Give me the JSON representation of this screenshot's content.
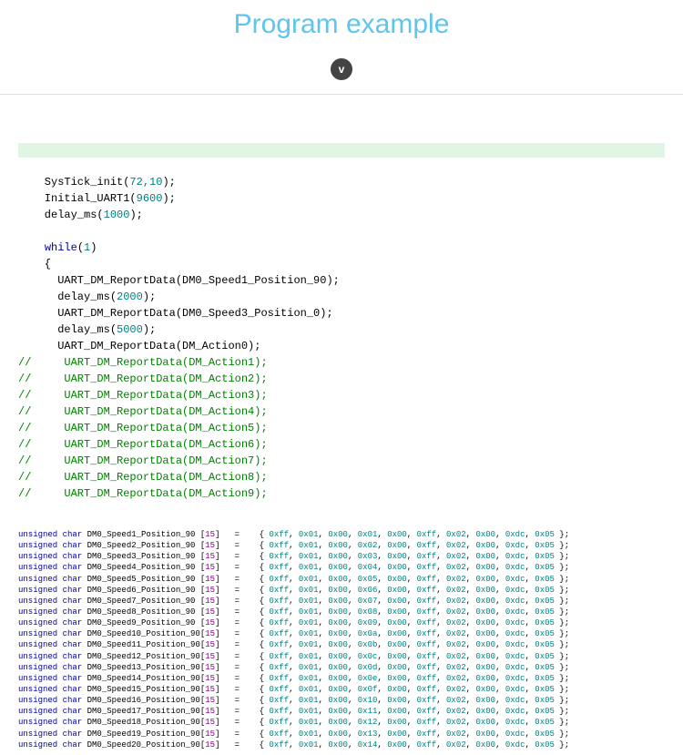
{
  "header": {
    "title": "Program example",
    "badge_char": "v"
  },
  "code": {
    "l1": "    SysTick_init(",
    "l1n": "72,10",
    "l1e": ");",
    "l2": "    Initial_UART1(",
    "l2n": "9600",
    "l2e": ");",
    "l3": "    delay_ms(",
    "l3n": "1000",
    "l3e": ");",
    "l4": "",
    "l5a": "    ",
    "l5b": "while",
    "l5c": "(",
    "l5d": "1",
    "l5e": ")",
    "l6": "    {",
    "l7": "      UART_DM_ReportData(DM0_Speed1_Position_90);",
    "l8": "      delay_ms(",
    "l8n": "2000",
    "l8e": ");",
    "l9": "      UART_DM_ReportData(DM0_Speed3_Position_0);",
    "l10": "      delay_ms(",
    "l10n": "5000",
    "l10e": ");",
    "l11": "      UART_DM_ReportData(DM_Action0);",
    "c1": "//     UART_DM_ReportData(DM_Action1);",
    "c2": "//     UART_DM_ReportData(DM_Action2);",
    "c3": "//     UART_DM_ReportData(DM_Action3);",
    "c4": "//     UART_DM_ReportData(DM_Action4);",
    "c5": "//     UART_DM_ReportData(DM_Action5);",
    "c6": "//     UART_DM_ReportData(DM_Action6);",
    "c7": "//     UART_DM_ReportData(DM_Action7);",
    "c8": "//     UART_DM_ReportData(DM_Action8);",
    "c9": "//     UART_DM_ReportData(DM_Action9);"
  },
  "arrays": [
    {
      "name": "DM0_Speed1_Position_90",
      "size": "15",
      "bytes": [
        "0xff",
        "0x01",
        "0x00",
        "0x01",
        "0x00",
        "0xff",
        "0x02",
        "0x00",
        "0xdc",
        "0x05"
      ]
    },
    {
      "name": "DM0_Speed2_Position_90",
      "size": "15",
      "bytes": [
        "0xff",
        "0x01",
        "0x00",
        "0x02",
        "0x00",
        "0xff",
        "0x02",
        "0x00",
        "0xdc",
        "0x05"
      ]
    },
    {
      "name": "DM0_Speed3_Position_90",
      "size": "15",
      "bytes": [
        "0xff",
        "0x01",
        "0x00",
        "0x03",
        "0x00",
        "0xff",
        "0x02",
        "0x00",
        "0xdc",
        "0x05"
      ]
    },
    {
      "name": "DM0_Speed4_Position_90",
      "size": "15",
      "bytes": [
        "0xff",
        "0x01",
        "0x00",
        "0x04",
        "0x00",
        "0xff",
        "0x02",
        "0x00",
        "0xdc",
        "0x05"
      ]
    },
    {
      "name": "DM0_Speed5_Position_90",
      "size": "15",
      "bytes": [
        "0xff",
        "0x01",
        "0x00",
        "0x05",
        "0x00",
        "0xff",
        "0x02",
        "0x00",
        "0xdc",
        "0x05"
      ]
    },
    {
      "name": "DM0_Speed6_Position_90",
      "size": "15",
      "bytes": [
        "0xff",
        "0x01",
        "0x00",
        "0x06",
        "0x00",
        "0xff",
        "0x02",
        "0x00",
        "0xdc",
        "0x05"
      ]
    },
    {
      "name": "DM0_Speed7_Position_90",
      "size": "15",
      "bytes": [
        "0xff",
        "0x01",
        "0x00",
        "0x07",
        "0x00",
        "0xff",
        "0x02",
        "0x00",
        "0xdc",
        "0x05"
      ]
    },
    {
      "name": "DM0_Speed8_Position_90",
      "size": "15",
      "bytes": [
        "0xff",
        "0x01",
        "0x00",
        "0x08",
        "0x00",
        "0xff",
        "0x02",
        "0x00",
        "0xdc",
        "0x05"
      ]
    },
    {
      "name": "DM0_Speed9_Position_90",
      "size": "15",
      "bytes": [
        "0xff",
        "0x01",
        "0x00",
        "0x09",
        "0x00",
        "0xff",
        "0x02",
        "0x00",
        "0xdc",
        "0x05"
      ]
    },
    {
      "name": "DM0_Speed10_Position_90",
      "size": "15",
      "bytes": [
        "0xff",
        "0x01",
        "0x00",
        "0x0a",
        "0x00",
        "0xff",
        "0x02",
        "0x00",
        "0xdc",
        "0x05"
      ]
    },
    {
      "name": "DM0_Speed11_Position_90",
      "size": "15",
      "bytes": [
        "0xff",
        "0x01",
        "0x00",
        "0x0b",
        "0x00",
        "0xff",
        "0x02",
        "0x00",
        "0xdc",
        "0x05"
      ]
    },
    {
      "name": "DM0_Speed12_Position_90",
      "size": "15",
      "bytes": [
        "0xff",
        "0x01",
        "0x00",
        "0x0c",
        "0x00",
        "0xff",
        "0x02",
        "0x00",
        "0xdc",
        "0x05"
      ]
    },
    {
      "name": "DM0_Speed13_Position_90",
      "size": "15",
      "bytes": [
        "0xff",
        "0x01",
        "0x00",
        "0x0d",
        "0x00",
        "0xff",
        "0x02",
        "0x00",
        "0xdc",
        "0x05"
      ]
    },
    {
      "name": "DM0_Speed14_Position_90",
      "size": "15",
      "bytes": [
        "0xff",
        "0x01",
        "0x00",
        "0x0e",
        "0x00",
        "0xff",
        "0x02",
        "0x00",
        "0xdc",
        "0x05"
      ]
    },
    {
      "name": "DM0_Speed15_Position_90",
      "size": "15",
      "bytes": [
        "0xff",
        "0x01",
        "0x00",
        "0x0f",
        "0x00",
        "0xff",
        "0x02",
        "0x00",
        "0xdc",
        "0x05"
      ]
    },
    {
      "name": "DM0_Speed16_Position_90",
      "size": "15",
      "bytes": [
        "0xff",
        "0x01",
        "0x00",
        "0x10",
        "0x00",
        "0xff",
        "0x02",
        "0x00",
        "0xdc",
        "0x05"
      ]
    },
    {
      "name": "DM0_Speed17_Position_90",
      "size": "15",
      "bytes": [
        "0xff",
        "0x01",
        "0x00",
        "0x11",
        "0x00",
        "0xff",
        "0x02",
        "0x00",
        "0xdc",
        "0x05"
      ]
    },
    {
      "name": "DM0_Speed18_Position_90",
      "size": "15",
      "bytes": [
        "0xff",
        "0x01",
        "0x00",
        "0x12",
        "0x00",
        "0xff",
        "0x02",
        "0x00",
        "0xdc",
        "0x05"
      ]
    },
    {
      "name": "DM0_Speed19_Position_90",
      "size": "15",
      "bytes": [
        "0xff",
        "0x01",
        "0x00",
        "0x13",
        "0x00",
        "0xff",
        "0x02",
        "0x00",
        "0xdc",
        "0x05"
      ]
    },
    {
      "name": "DM0_Speed20_Position_90",
      "size": "15",
      "bytes": [
        "0xff",
        "0x01",
        "0x00",
        "0x14",
        "0x00",
        "0xff",
        "0x02",
        "0x00",
        "0xdc",
        "0x05"
      ]
    }
  ],
  "array_kw": "unsigned char"
}
